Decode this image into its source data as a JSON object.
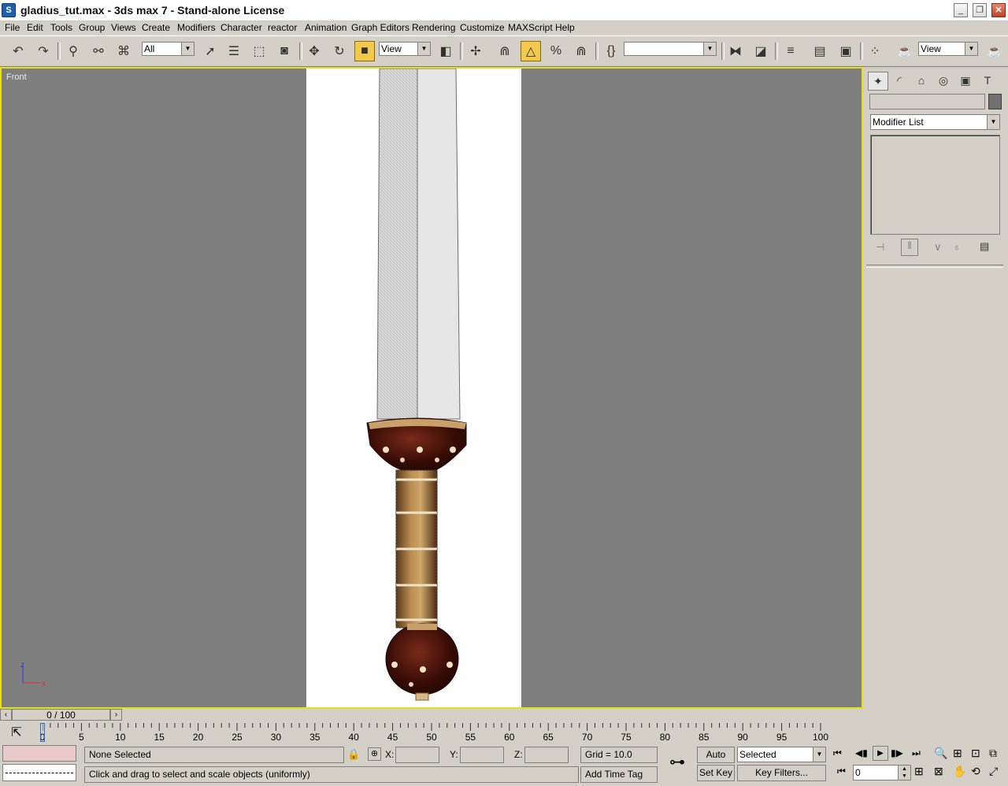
{
  "window": {
    "title": "gladius_tut.max - 3ds max 7  - Stand-alone License",
    "app_icon": "3ds-max-icon",
    "controls": [
      "minimize-icon",
      "restore-icon",
      "close-icon"
    ]
  },
  "menu": [
    "File",
    "Edit",
    "Tools",
    "Group",
    "Views",
    "Create",
    "Modifiers",
    "Character",
    "reactor",
    "Animation",
    "Graph Editors",
    "Rendering",
    "Customize",
    "MAXScript",
    "Help"
  ],
  "toolbar": {
    "selection_filter": "All",
    "ref_coord": "View",
    "named_selection": "",
    "render_view": "View"
  },
  "viewport": {
    "label": "Front",
    "axis_z": "z",
    "axis_x": "x"
  },
  "command_panel": {
    "name_field": "",
    "modifier_list": "Modifier List"
  },
  "timeline": {
    "frame_counter": "0 / 100",
    "ticks": [
      "0",
      "5",
      "10",
      "15",
      "20",
      "25",
      "30",
      "35",
      "40",
      "45",
      "50",
      "55",
      "60",
      "65",
      "70",
      "75",
      "80",
      "85",
      "90",
      "95",
      "100"
    ]
  },
  "status": {
    "selection": "None Selected",
    "prompt": "Click and drag to select and scale objects (uniformly)",
    "x_label": "X:",
    "y_label": "Y:",
    "z_label": "Z:",
    "grid": "Grid = 10.0",
    "add_time_tag": "Add Time Tag",
    "auto_key": "Auto Key",
    "set_key": "Set Key",
    "key_mode": "Selected",
    "key_filters": "Key Filters...",
    "current_frame": "0"
  },
  "colors": {
    "viewport_bg": "#7f7f7f",
    "active_border": "#e8df1b",
    "ui_face": "#d4d0c8"
  }
}
